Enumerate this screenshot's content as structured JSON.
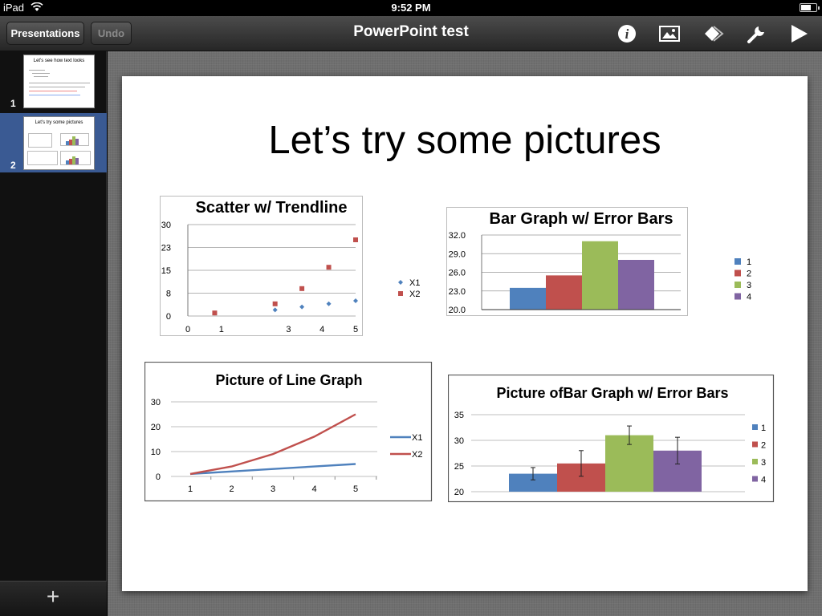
{
  "status": {
    "device": "iPad",
    "time": "9:52 PM"
  },
  "toolbar": {
    "presentations_label": "Presentations",
    "undo_label": "Undo",
    "title": "PowerPoint test",
    "icons": [
      "info-icon",
      "image-icon",
      "shapes-icon",
      "wrench-icon",
      "play-icon"
    ]
  },
  "sidebar": {
    "slides": [
      {
        "number": "1",
        "title": "Let's see how text looks"
      },
      {
        "number": "2",
        "title": "Let's try some pictures"
      }
    ],
    "add_label": "+"
  },
  "slide": {
    "title": "Let’s try some pictures"
  },
  "chart_data": [
    {
      "type": "scatter",
      "title": "Scatter w/ Trendline",
      "xlim": [
        0,
        5
      ],
      "ylim": [
        0,
        30
      ],
      "xticks": [
        "0",
        "1",
        "3",
        "4",
        "5"
      ],
      "yticks": [
        "30",
        "23",
        "15",
        "8",
        "0"
      ],
      "series": [
        {
          "name": "X1",
          "color": "#4f81bd",
          "x": [
            0.8,
            2.6,
            3.4,
            4.2,
            5
          ],
          "y": [
            1,
            2,
            3,
            4,
            5
          ]
        },
        {
          "name": "X2",
          "color": "#c0504d",
          "x": [
            0.8,
            2.6,
            3.4,
            4.2,
            5
          ],
          "y": [
            1,
            4,
            9,
            16,
            25
          ]
        }
      ],
      "legend": "right"
    },
    {
      "type": "bar",
      "title": "Bar Graph w/ Error Bars",
      "ylim": [
        20,
        32
      ],
      "yticks": [
        "32.0",
        "29.0",
        "26.0",
        "23.0",
        "20.0"
      ],
      "categories": [
        "1",
        "2",
        "3",
        "4"
      ],
      "values": [
        23.5,
        25.5,
        31,
        28
      ],
      "colors": [
        "#4f81bd",
        "#c0504d",
        "#9bbb59",
        "#8064a2"
      ],
      "legend": "right"
    },
    {
      "type": "line",
      "title": "Picture of Line Graph",
      "x": [
        "1",
        "2",
        "3",
        "4",
        "5"
      ],
      "ylim": [
        0,
        30
      ],
      "yticks": [
        "30",
        "20",
        "10",
        "0"
      ],
      "series": [
        {
          "name": "X1",
          "color": "#4f81bd",
          "values": [
            1,
            2,
            3,
            4,
            5
          ]
        },
        {
          "name": "X2",
          "color": "#c0504d",
          "values": [
            1,
            4,
            9,
            16,
            25
          ]
        }
      ],
      "legend": "right"
    },
    {
      "type": "bar",
      "title": "Picture ofBar Graph w/ Error Bars",
      "ylim": [
        20,
        35
      ],
      "yticks": [
        "35",
        "30",
        "25",
        "20"
      ],
      "categories": [
        "1",
        "2",
        "3",
        "4"
      ],
      "values": [
        23.5,
        25.5,
        31,
        28
      ],
      "errors": [
        1.2,
        2.5,
        1.8,
        2.6
      ],
      "colors": [
        "#4f81bd",
        "#c0504d",
        "#9bbb59",
        "#8064a2"
      ],
      "legend": "right"
    }
  ]
}
